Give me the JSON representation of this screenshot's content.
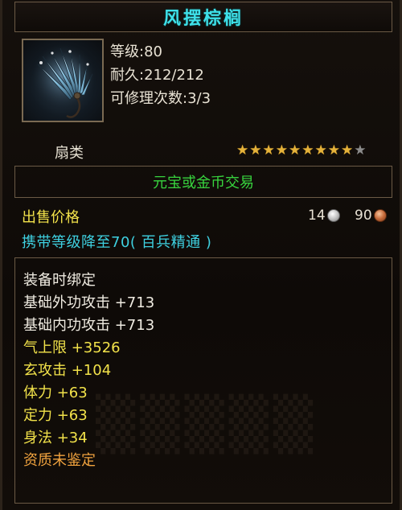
{
  "item": {
    "name": "风摆棕榈",
    "level_text": "等级:80",
    "durability_text": "耐久:212/212",
    "repair_text": "可修理次数:3/3",
    "type": "扇类",
    "stars_filled": 9,
    "stars_total": 10,
    "trade_text": "元宝或金币交易",
    "sale_label": "出售价格",
    "price_silver": "14",
    "price_copper": "90",
    "level_reduce_text": "携带等级降至70( 百兵精通 )"
  },
  "attributes": [
    {
      "text": "装备时绑定",
      "color": "white"
    },
    {
      "text": "基础外功攻击 +713",
      "color": "white"
    },
    {
      "text": "基础内功攻击 +713",
      "color": "white"
    },
    {
      "text": "气上限 +3526",
      "color": "yellow"
    },
    {
      "text": "玄攻击 +104",
      "color": "yellow"
    },
    {
      "text": "体力 +63",
      "color": "yellow"
    },
    {
      "text": "定力 +63",
      "color": "yellow"
    },
    {
      "text": "身法 +34",
      "color": "yellow"
    },
    {
      "text": "资质未鉴定",
      "color": "orange"
    }
  ],
  "colors": {
    "title": "#3ee0e8",
    "trade": "#38d43e",
    "sale_label": "#f2e24a",
    "level_reduce": "#3ed0e0",
    "star_filled": "#e5b23a",
    "star_empty": "#8d8d8d"
  },
  "icons": {
    "item_icon": "fan-weapon-icon",
    "silver_coin": "silver-coin-icon",
    "copper_coin": "copper-coin-icon"
  }
}
